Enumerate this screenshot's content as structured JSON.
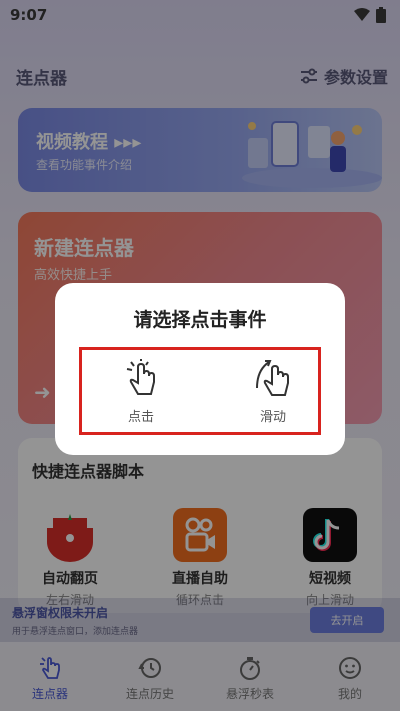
{
  "status_bar": {
    "time": "9:07"
  },
  "header": {
    "title": "连点器",
    "settings_label": "参数设置"
  },
  "video_card": {
    "title": "视频教程 ▸▸▸",
    "subtitle": "查看功能事件介绍"
  },
  "new_card": {
    "title": "新建连点器",
    "subtitle": "高效快捷上手"
  },
  "quick_scripts": {
    "title": "快捷连点器脚本",
    "items": [
      {
        "name": "自动翻页",
        "desc": "左右滑动"
      },
      {
        "name": "直播自助",
        "desc": "循环点击"
      },
      {
        "name": "短视频",
        "desc": "向上滑动"
      }
    ]
  },
  "floating_banner": {
    "title": "悬浮窗权限未开启",
    "subtitle": "用于悬浮连点窗口，添加连点器",
    "button": "去开启"
  },
  "tabs": [
    {
      "label": "连点器",
      "active": true
    },
    {
      "label": "连点历史",
      "active": false
    },
    {
      "label": "悬浮秒表",
      "active": false
    },
    {
      "label": "我的",
      "active": false
    }
  ],
  "dialog": {
    "title": "请选择点击事件",
    "options": [
      {
        "label": "点击"
      },
      {
        "label": "滑动"
      }
    ]
  },
  "colors": {
    "accent": "#4a5ad6",
    "highlight": "#d8231e"
  }
}
